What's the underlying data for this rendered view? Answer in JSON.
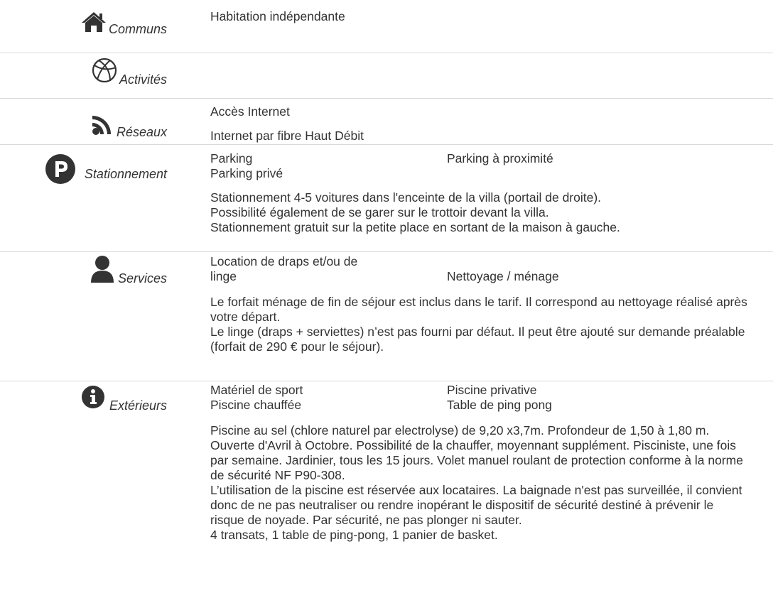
{
  "sections": {
    "communs": {
      "label": "Communs",
      "icon": "home-icon",
      "items": [
        "Habitation indépendante"
      ]
    },
    "activites": {
      "label": "Activités",
      "icon": "basketball-icon",
      "items": []
    },
    "reseaux": {
      "label": "Réseaux",
      "icon": "rss-icon",
      "items": [
        "Accès Internet"
      ],
      "note": "Internet par fibre Haut Débit"
    },
    "stationnement": {
      "label": "Stationnement",
      "icon": "parking-icon",
      "items": [
        "Parking",
        "Parking à proximité",
        "Parking privé"
      ],
      "note": [
        "Stationnement 4-5 voitures dans l'enceinte de la villa (portail de droite).",
        "Possibilité également de se garer sur le trottoir devant la villa.",
        "Stationnement gratuit sur la petite place en sortant de la maison à gauche."
      ]
    },
    "services": {
      "label": "Services",
      "icon": "user-icon",
      "items": [
        "Location de draps et/ou de\nlinge",
        "Nettoyage / ménage"
      ],
      "note": [
        "Le forfait ménage de fin de séjour est inclus dans le tarif. Il correspond au nettoyage réalisé après votre départ.",
        "Le linge (draps + serviettes) n’est pas fourni par défaut. Il peut être ajouté sur demande préalable (forfait de 290 € pour le séjour)."
      ]
    },
    "exterieurs": {
      "label": "Extérieurs",
      "icon": "info-icon",
      "items": [
        "Matériel de sport",
        "Piscine privative",
        "Piscine chauffée",
        "Table de ping pong"
      ],
      "note": [
        "Piscine au sel (chlore naturel par electrolyse) de 9,20 x3,7m. Profondeur de 1,50 à 1,80 m. Ouverte d'Avril à Octobre. Possibilité de la chauffer, moyennant supplément. Pisciniste, une fois par semaine. Jardinier, tous les 15 jours. Volet manuel roulant de protection conforme à la norme de sécurité NF P90-308.",
        "L’utilisation de la piscine est réservée aux locataires. La baignade n'est pas surveillée, il convient donc de ne pas neutraliser ou rendre inopérant le dispositif de sécurité destiné à prévenir le risque de noyade. Par sécurité, ne pas plonger ni sauter.",
        "4 transats, 1 table de ping-pong, 1 panier de basket."
      ]
    }
  }
}
